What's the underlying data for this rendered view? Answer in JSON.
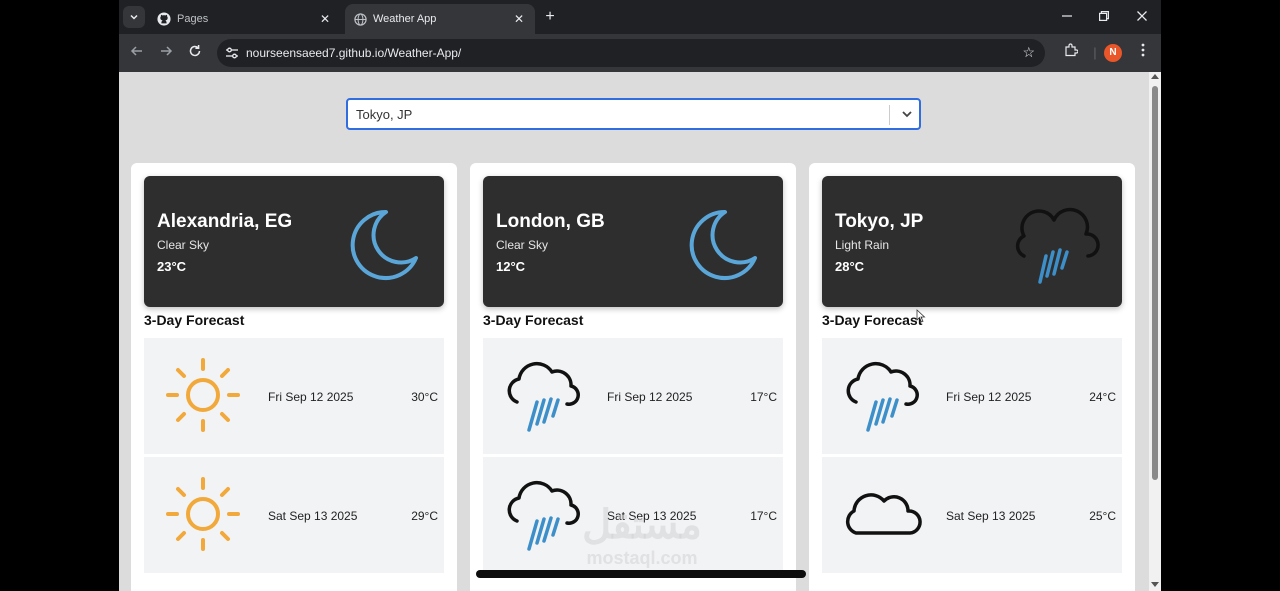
{
  "browser": {
    "tabs": [
      {
        "label": "Pages",
        "icon": "github-icon",
        "active": false
      },
      {
        "label": "Weather App",
        "icon": "globe-icon",
        "active": true
      }
    ],
    "url": "nourseensaeed7.github.io/Weather-App/",
    "profile_initial": "N",
    "accent_color": "#e8562a"
  },
  "search": {
    "selected_city": "Tokyo, JP"
  },
  "forecast_title": "3-Day Forecast",
  "cities": [
    {
      "city": "Alexandria, EG",
      "condition": "Clear Sky",
      "temp": "23°C",
      "icon": "moon-icon",
      "forecast": [
        {
          "date": "Fri Sep 12 2025",
          "temp": "30°C",
          "icon": "sun-icon"
        },
        {
          "date": "Sat Sep 13 2025",
          "temp": "29°C",
          "icon": "sun-icon"
        }
      ]
    },
    {
      "city": "London, GB",
      "condition": "Clear Sky",
      "temp": "12°C",
      "icon": "moon-icon",
      "forecast": [
        {
          "date": "Fri Sep 12 2025",
          "temp": "17°C",
          "icon": "rain-cloud-icon"
        },
        {
          "date": "Sat Sep 13 2025",
          "temp": "17°C",
          "icon": "rain-cloud-icon"
        }
      ]
    },
    {
      "city": "Tokyo, JP",
      "condition": "Light Rain",
      "temp": "28°C",
      "icon": "rain-cloud-icon",
      "forecast": [
        {
          "date": "Fri Sep 12 2025",
          "temp": "24°C",
          "icon": "rain-cloud-icon"
        },
        {
          "date": "Sat Sep 13 2025",
          "temp": "25°C",
          "icon": "cloud-icon"
        }
      ]
    }
  ],
  "watermark": {
    "arabic": "مستقل",
    "latin": "mostaql.com"
  }
}
